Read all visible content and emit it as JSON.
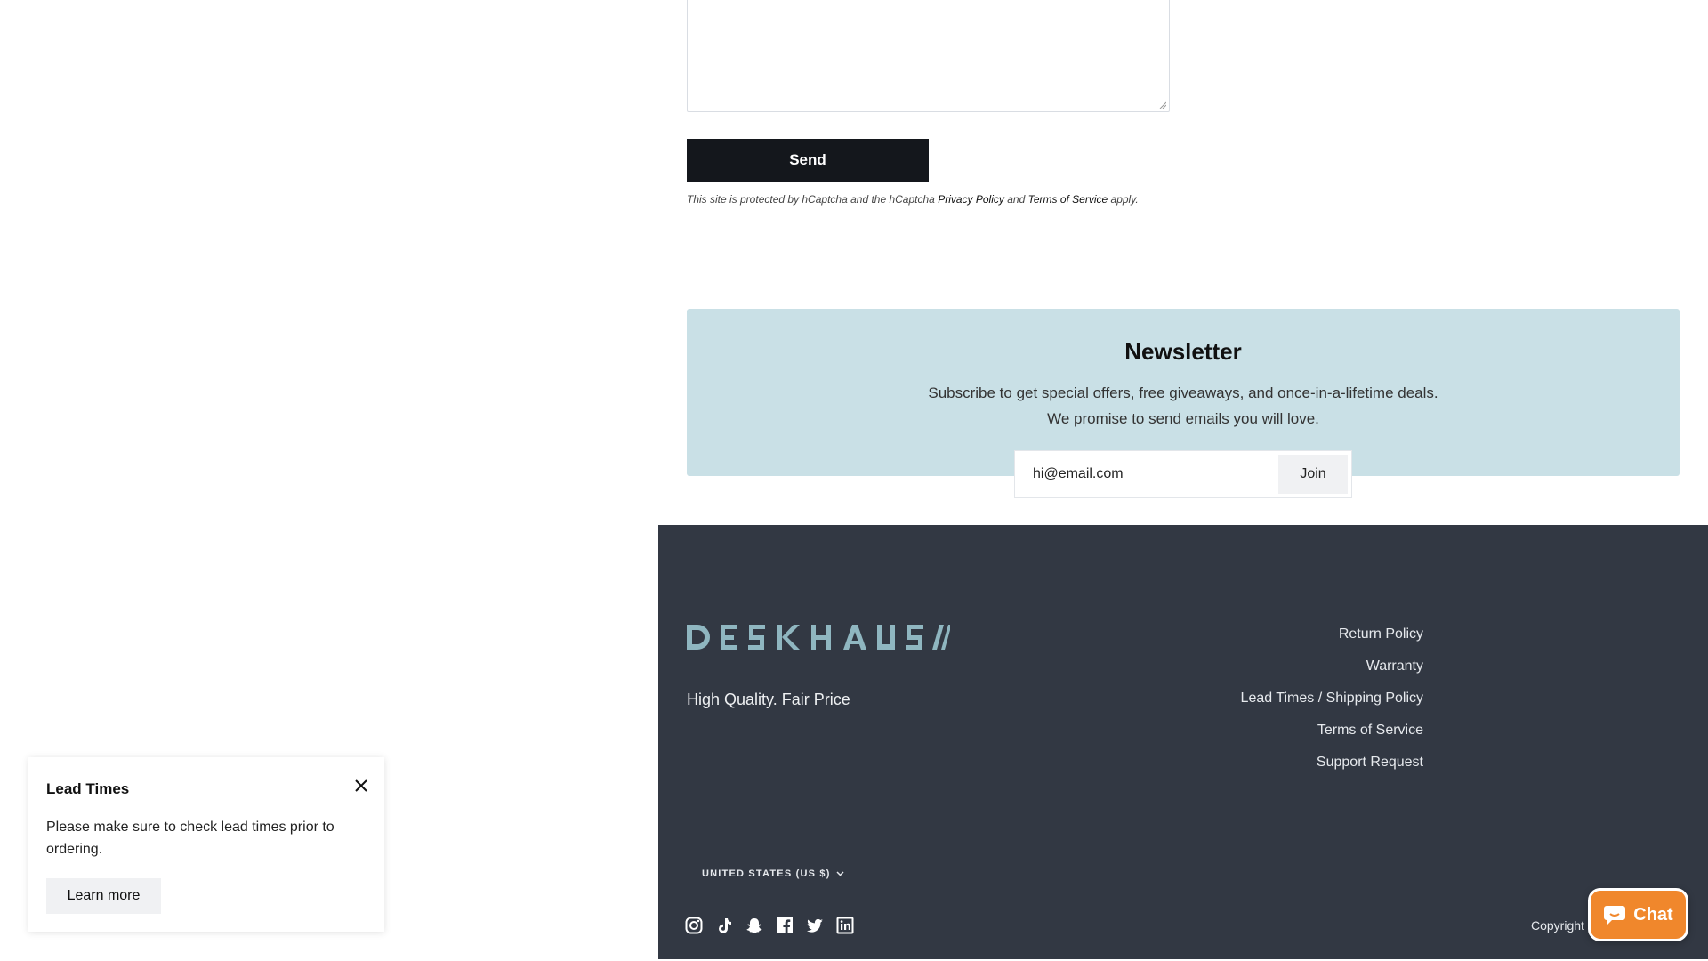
{
  "contact": {
    "send_label": "Send",
    "captcha": {
      "prefix": "This site is protected by hCaptcha and the hCaptcha",
      "privacy_link": "Privacy Policy",
      "and": "and",
      "terms_link": "Terms of Service",
      "suffix": "apply."
    }
  },
  "newsletter": {
    "title": "Newsletter",
    "description": "Subscribe to get special offers, free giveaways, and once-in-a-lifetime deals. We promise to send emails you will love.",
    "email_placeholder": "hi@email.com",
    "join_label": "Join"
  },
  "footer": {
    "logo_text": "DESKHAUS",
    "tagline": "High Quality. Fair Price",
    "links": [
      "Return Policy",
      "Warranty",
      "Lead Times / Shipping Policy",
      "Terms of Service",
      "Support Request"
    ],
    "region": "UNITED STATES (US $)",
    "socials": [
      "instagram-icon",
      "tiktok-icon",
      "snapchat-icon",
      "facebook-icon",
      "twitter-icon",
      "linkedin-icon"
    ],
    "copyright": "Copyright ©"
  },
  "chat": {
    "label": "Chat",
    "color": "#f0872c"
  },
  "popup": {
    "title": "Lead Times",
    "body": "Please make sure to check lead times prior to ordering.",
    "button_label": "Learn more"
  },
  "colors": {
    "footer_bg": "#323843",
    "newsletter_bg": "#c9e0e6",
    "logo": "#8fb6c0",
    "button_dark": "#14171c"
  }
}
